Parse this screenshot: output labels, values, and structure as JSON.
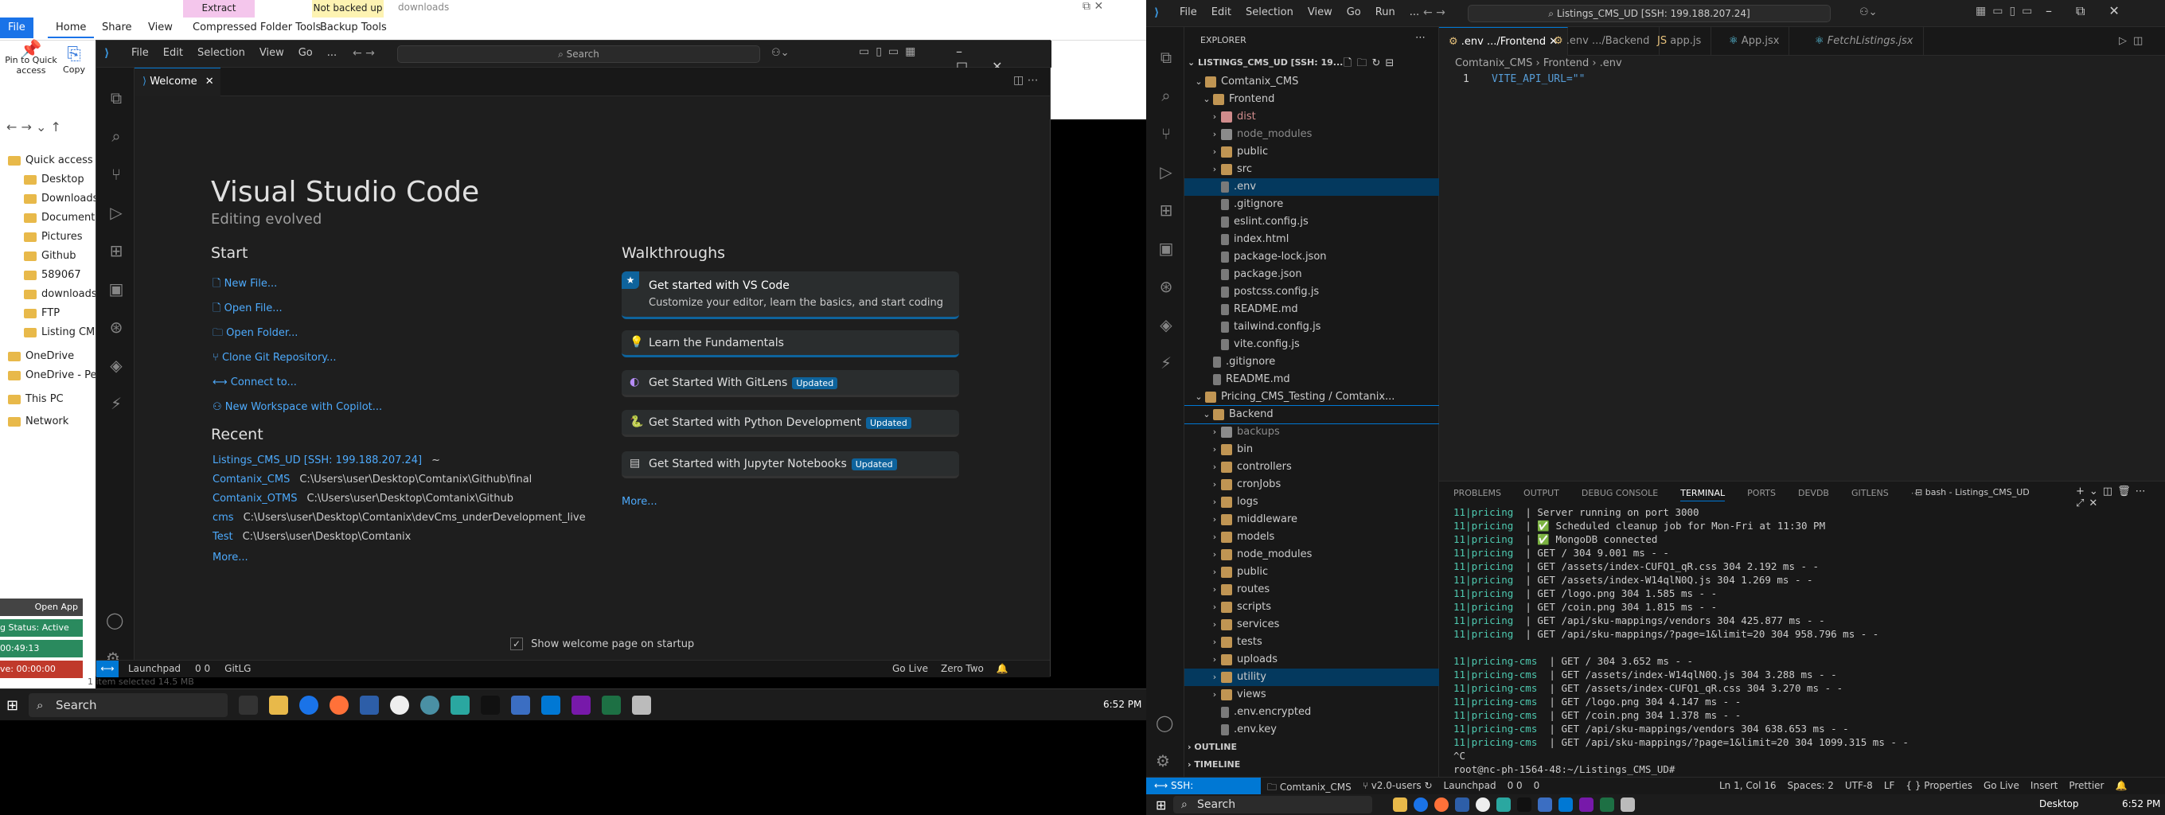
{
  "explorer": {
    "title_bar_text": "downloads",
    "contextual_tabs": [
      "Extract",
      "Not backed up"
    ],
    "ribbon_tabs": [
      "File",
      "Home",
      "Share",
      "View",
      "Compressed Folder Tools",
      "Backup Tools"
    ],
    "ribbon_buttons": [
      "Pin to Quick access",
      "Copy"
    ],
    "nav_items": [
      "Quick access",
      "Desktop",
      "Downloads",
      "Documents",
      "Pictures",
      "Github",
      "589067",
      "downloads",
      "FTP",
      "Listing CMS",
      "OneDrive",
      "OneDrive - Pe",
      "This PC",
      "Network"
    ],
    "status": "1 item selected  14.5 MB",
    "widget": {
      "open_app": "Open App",
      "status": "g Status: Active",
      "timer1": "00:49:13",
      "timer2": "ve: 00:00:00"
    }
  },
  "vscode_welcome": {
    "menu": [
      "File",
      "Edit",
      "Selection",
      "View",
      "Go",
      "..."
    ],
    "search_placeholder": "Search",
    "tab": "Welcome",
    "heading": "Visual Studio Code",
    "subheading": "Editing evolved",
    "start_title": "Start",
    "start_items": [
      "New File...",
      "Open File...",
      "Open Folder...",
      "Clone Git Repository...",
      "Connect to...",
      "New Workspace with Copilot..."
    ],
    "recent_title": "Recent",
    "recent": [
      {
        "name": "Listings_CMS_UD [SSH: 199.188.207.24]",
        "path": "~"
      },
      {
        "name": "Comtanix_CMS",
        "path": "C:\\Users\\user\\Desktop\\Comtanix\\Github\\final"
      },
      {
        "name": "Comtanix_OTMS",
        "path": "C:\\Users\\user\\Desktop\\Comtanix\\Github"
      },
      {
        "name": "cms",
        "path": "C:\\Users\\user\\Desktop\\Comtanix\\devCms_underDevelopment_live"
      },
      {
        "name": "Test",
        "path": "C:\\Users\\user\\Desktop\\Comtanix"
      }
    ],
    "recent_more": "More...",
    "walkthroughs_title": "Walkthroughs",
    "walkthroughs": [
      {
        "title": "Get started with VS Code",
        "desc": "Customize your editor, learn the basics, and start coding",
        "badge": ""
      },
      {
        "title": "Learn the Fundamentals",
        "desc": "",
        "badge": ""
      },
      {
        "title": "Get Started With GitLens",
        "desc": "",
        "badge": "Updated"
      },
      {
        "title": "Get Started with Python Development",
        "desc": "",
        "badge": "Updated"
      },
      {
        "title": "Get Started with Jupyter Notebooks",
        "desc": "",
        "badge": "Updated"
      }
    ],
    "walk_more": "More...",
    "show_welcome": "Show welcome page on startup",
    "status": {
      "launchpad": "Launchpad",
      "problems": "0  0",
      "git": "GitLG",
      "golive": "Go Live",
      "zero": "Zero Two"
    }
  },
  "taskbar_left": {
    "search": "Search",
    "time": "6:52 PM"
  },
  "vscode_remote": {
    "menu": [
      "File",
      "Edit",
      "Selection",
      "View",
      "Go",
      "Run",
      "..."
    ],
    "search": "Listings_CMS_UD [SSH: 199.188.207.24]",
    "explorer_title": "EXPLORER",
    "workspace": "LISTINGS_CMS_UD [SSH: 19...",
    "tree": [
      {
        "label": "Comtanix_CMS",
        "depth": 1,
        "kind": "open"
      },
      {
        "label": "Frontend",
        "depth": 2,
        "kind": "open"
      },
      {
        "label": "dist",
        "depth": 3,
        "kind": "closed",
        "color": "#d18c8c"
      },
      {
        "label": "node_modules",
        "depth": 3,
        "kind": "closed",
        "color": "#8b8b8b"
      },
      {
        "label": "public",
        "depth": 3,
        "kind": "closed"
      },
      {
        "label": "src",
        "depth": 3,
        "kind": "closed"
      },
      {
        "label": ".env",
        "depth": 3,
        "kind": "file",
        "selected": true
      },
      {
        "label": ".gitignore",
        "depth": 3,
        "kind": "file"
      },
      {
        "label": "eslint.config.js",
        "depth": 3,
        "kind": "file"
      },
      {
        "label": "index.html",
        "depth": 3,
        "kind": "file"
      },
      {
        "label": "package-lock.json",
        "depth": 3,
        "kind": "file"
      },
      {
        "label": "package.json",
        "depth": 3,
        "kind": "file"
      },
      {
        "label": "postcss.config.js",
        "depth": 3,
        "kind": "file"
      },
      {
        "label": "README.md",
        "depth": 3,
        "kind": "file"
      },
      {
        "label": "tailwind.config.js",
        "depth": 3,
        "kind": "file"
      },
      {
        "label": "vite.config.js",
        "depth": 3,
        "kind": "file"
      },
      {
        "label": ".gitignore",
        "depth": 2,
        "kind": "file"
      },
      {
        "label": "README.md",
        "depth": 2,
        "kind": "file"
      },
      {
        "label": "Pricing_CMS_Testing / Comtanix...",
        "depth": 1,
        "kind": "open"
      },
      {
        "label": "Backend",
        "depth": 2,
        "kind": "open",
        "boxed": true
      },
      {
        "label": "backups",
        "depth": 3,
        "kind": "closed",
        "color": "#8b8b8b"
      },
      {
        "label": "bin",
        "depth": 3,
        "kind": "closed"
      },
      {
        "label": "controllers",
        "depth": 3,
        "kind": "closed"
      },
      {
        "label": "cronJobs",
        "depth": 3,
        "kind": "closed"
      },
      {
        "label": "logs",
        "depth": 3,
        "kind": "closed"
      },
      {
        "label": "middleware",
        "depth": 3,
        "kind": "closed"
      },
      {
        "label": "models",
        "depth": 3,
        "kind": "closed"
      },
      {
        "label": "node_modules",
        "depth": 3,
        "kind": "closed"
      },
      {
        "label": "public",
        "depth": 3,
        "kind": "closed"
      },
      {
        "label": "routes",
        "depth": 3,
        "kind": "closed"
      },
      {
        "label": "scripts",
        "depth": 3,
        "kind": "closed"
      },
      {
        "label": "services",
        "depth": 3,
        "kind": "closed"
      },
      {
        "label": "tests",
        "depth": 3,
        "kind": "closed"
      },
      {
        "label": "uploads",
        "depth": 3,
        "kind": "closed"
      },
      {
        "label": "utility",
        "depth": 3,
        "kind": "closed",
        "selected": true
      },
      {
        "label": "views",
        "depth": 3,
        "kind": "closed"
      },
      {
        "label": ".env.encrypted",
        "depth": 3,
        "kind": "file"
      },
      {
        "label": ".env.key",
        "depth": 3,
        "kind": "file"
      }
    ],
    "outline": "OUTLINE",
    "timeline": "TIMELINE",
    "tabs": [
      ".env  .../Frontend",
      ".env  .../Backend",
      "app.js",
      "App.jsx",
      "FetchListings.jsx"
    ],
    "breadcrumb": [
      "Comtanix_CMS",
      "Frontend",
      ".env"
    ],
    "code_line_no": "1",
    "code_line": "VITE_API_URL=\"\"",
    "panel_tabs": [
      "PROBLEMS",
      "OUTPUT",
      "DEBUG CONSOLE",
      "TERMINAL",
      "PORTS",
      "DEVDB",
      "GITLENS"
    ],
    "terminal_name": "bash - Listings_CMS_UD",
    "terminal_lines": [
      "11|pricing  | Server running on port 3000",
      "11|pricing  | ✅ Scheduled cleanup job for Mon-Fri at 11:30 PM",
      "11|pricing  | ✅ MongoDB connected",
      "11|pricing  | GET / 304 9.001 ms - -",
      "11|pricing  | GET /assets/index-CUFQ1_qR.css 304 2.192 ms - -",
      "11|pricing  | GET /assets/index-W14qlN0Q.js 304 1.269 ms - -",
      "11|pricing  | GET /logo.png 304 1.585 ms - -",
      "11|pricing  | GET /coin.png 304 1.815 ms - -",
      "11|pricing  | GET /api/sku-mappings/vendors 304 425.877 ms - -",
      "11|pricing  | GET /api/sku-mappings/?page=1&limit=20 304 958.796 ms - -",
      "",
      "11|pricing-cms  | GET / 304 3.652 ms - -",
      "11|pricing-cms  | GET /assets/index-W14qlN0Q.js 304 3.288 ms - -",
      "11|pricing-cms  | GET /assets/index-CUFQ1_qR.css 304 3.270 ms - -",
      "11|pricing-cms  | GET /logo.png 304 4.147 ms - -",
      "11|pricing-cms  | GET /coin.png 304 1.378 ms - -",
      "11|pricing-cms  | GET /api/sku-mappings/vendors 304 638.653 ms - -",
      "11|pricing-cms  | GET /api/sku-mappings/?page=1&limit=20 304 1099.315 ms - -",
      "^C",
      "root@nc-ph-1564-48:~/Listings_CMS_UD# "
    ],
    "status": {
      "ssh": "SSH: 199.188.207.24",
      "branch": "Comtanix_CMS",
      "version": "v2.0-users",
      "launchpad": "Launchpad",
      "problems": "0  0",
      "ports": "0",
      "position": "Ln 1, Col 16",
      "spaces": "Spaces: 2",
      "encoding": "UTF-8",
      "eol": "LF",
      "lang": "{ } Properties",
      "golive": "Go Live",
      "insert": "Insert",
      "prettier": "Prettier"
    }
  },
  "taskbar_right": {
    "search": "Search",
    "desktop": "Desktop",
    "time": "6:52 PM"
  }
}
